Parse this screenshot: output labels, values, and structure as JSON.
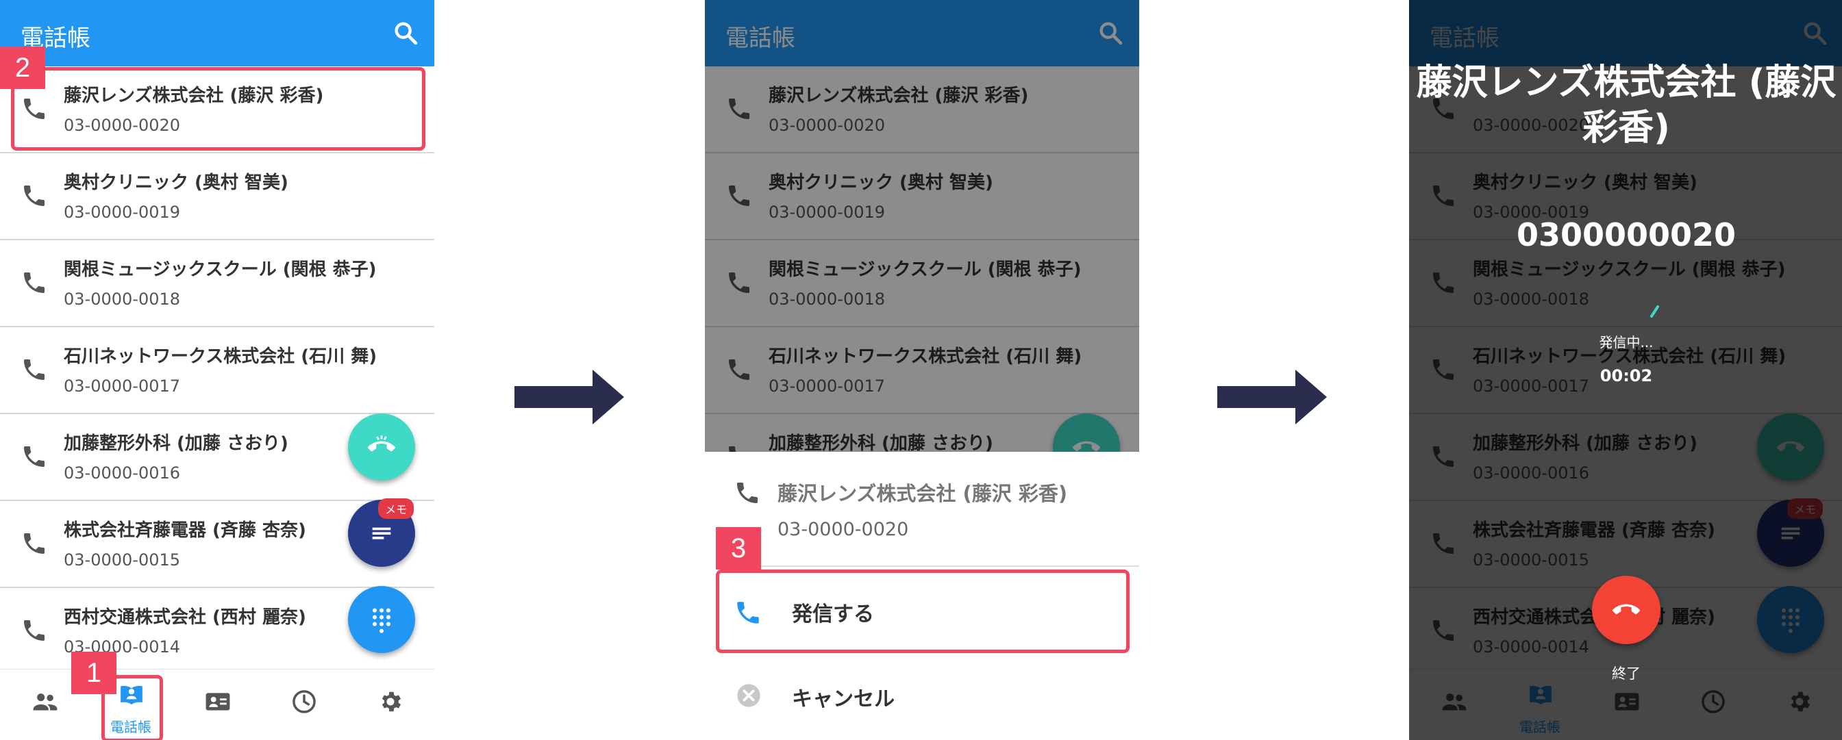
{
  "app_title": "電話帳",
  "contacts": [
    {
      "name": "藤沢レンズ株式会社 (藤沢 彩香)",
      "number": "03-0000-0020"
    },
    {
      "name": "奥村クリニック (奥村 智美)",
      "number": "03-0000-0019"
    },
    {
      "name": "関根ミュージックスクール (関根 恭子)",
      "number": "03-0000-0018"
    },
    {
      "name": "石川ネットワークス株式会社 (石川 舞)",
      "number": "03-0000-0017"
    },
    {
      "name": "加藤整形外科 (加藤 さおり)",
      "number": "03-0000-0016"
    },
    {
      "name": "株式会社斉藤電器 (斉藤 杏奈)",
      "number": "03-0000-0015"
    },
    {
      "name": "西村交通株式会社 (西村 麗奈)",
      "number": "03-0000-0014"
    }
  ],
  "fab": {
    "memo_badge": "メモ"
  },
  "bottom_nav": {
    "phonebook_label": "電話帳"
  },
  "steps": {
    "step1": "1",
    "step2": "2",
    "step3": "3"
  },
  "sheet": {
    "contact_name": "藤沢レンズ株式会社 (藤沢 彩香)",
    "contact_number": "03-0000-0020",
    "call_label": "発信する",
    "cancel_label": "キャンセル"
  },
  "call": {
    "title_line1": "藤沢レンズ株式会社 (藤沢",
    "title_line2": "彩香)",
    "number": "0300000020",
    "status": "発信中...",
    "timer": "00:02",
    "end_label": "終了"
  },
  "colors": {
    "primary": "#2196F3",
    "accent_teal": "#3ED9C7",
    "accent_navy": "#283A8A",
    "highlight": "#F0465F",
    "end_call": "#F44336",
    "arrow": "#2B2D4F"
  }
}
